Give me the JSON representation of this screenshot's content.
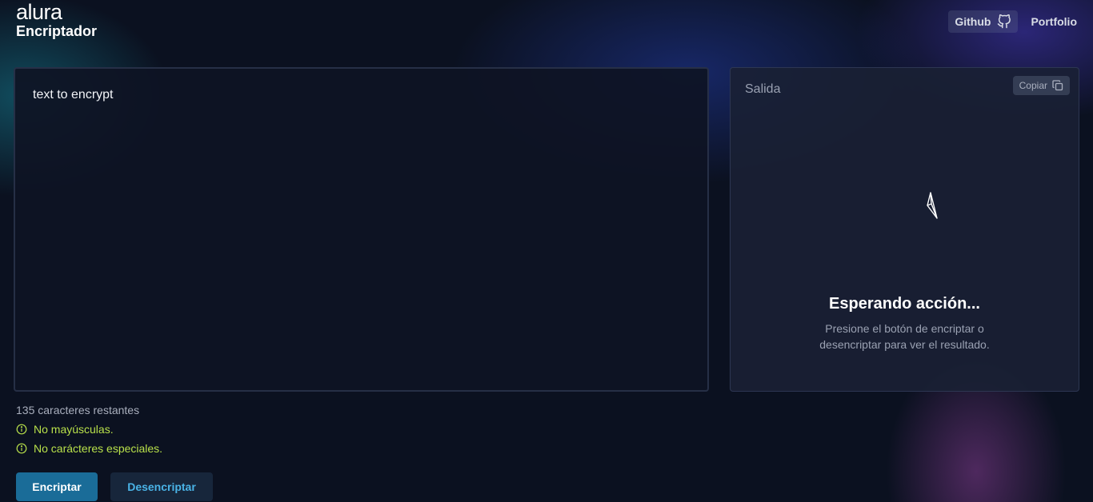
{
  "logo": {
    "brand": "alura",
    "title": "Encriptador"
  },
  "nav": {
    "github_label": "Github",
    "portfolio_label": "Portfolio"
  },
  "input": {
    "value": "text to encrypt"
  },
  "output": {
    "label": "Salida",
    "copy_label": "Copiar",
    "waiting_title": "Esperando acción...",
    "waiting_desc": "Presione el botón de encriptar o desencriptar para ver el resultado."
  },
  "info": {
    "remaining": "135 caracteres restantes",
    "rules": [
      "No mayúsculas.",
      "No carácteres especiales."
    ]
  },
  "actions": {
    "encrypt_label": "Encriptar",
    "decrypt_label": "Desencriptar"
  },
  "colors": {
    "accent": "#1a6c98",
    "warning": "#b8e04a",
    "secondary_text": "#4ab3e6"
  }
}
